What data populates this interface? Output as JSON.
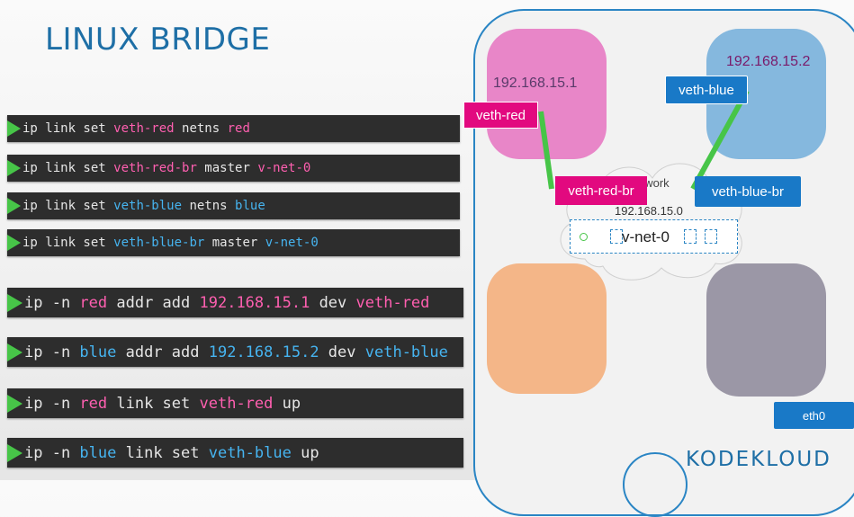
{
  "title": "LINUX BRIDGE",
  "commands": [
    {
      "parts": [
        "ip link set ",
        "veth-red",
        " netns ",
        "red"
      ]
    },
    {
      "parts": [
        "ip link set ",
        "veth-red-br",
        " master ",
        "v-net-0"
      ]
    },
    {
      "parts": [
        "ip link set ",
        "veth-blue",
        " netns ",
        "blue"
      ]
    },
    {
      "parts": [
        "ip link set ",
        "veth-blue-br",
        " master ",
        "v-net-0"
      ]
    },
    {
      "parts": [
        "ip -n ",
        "red",
        " addr add ",
        "192.168.15.1",
        " dev ",
        "veth-red"
      ]
    },
    {
      "parts": [
        "ip -n ",
        "blue",
        " addr add ",
        "192.168.15.2",
        " dev ",
        "veth-blue"
      ]
    },
    {
      "parts": [
        "ip -n ",
        "red",
        " link set ",
        "veth-red",
        " up"
      ]
    },
    {
      "parts": [
        "ip -n ",
        "blue",
        " link set ",
        "veth-blue",
        " up"
      ]
    }
  ],
  "diagram": {
    "red_ip": "192.168.15.1",
    "blue_ip": "192.168.15.2",
    "veth_red": "veth-red",
    "veth_blue": "veth-blue",
    "veth_red_br": "veth-red-br",
    "veth_blue_br": "veth-blue-br",
    "network_label": "Network",
    "network_ip": "192.168.15.0",
    "bridge_label": "v-net-0",
    "eth0": "eth0"
  },
  "logo": "KODEKLOUD",
  "colors": {
    "accent": "#1e6fa6",
    "red": "#e2097f",
    "blue": "#1979c7",
    "green": "#47c548"
  }
}
